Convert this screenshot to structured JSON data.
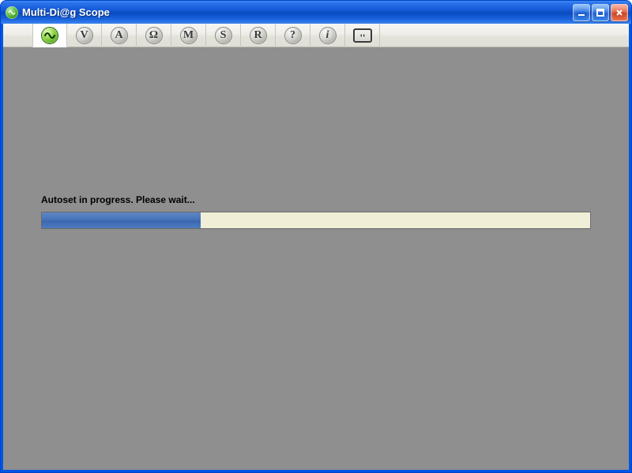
{
  "window": {
    "title": "Multi-Di@g Scope"
  },
  "toolbar": {
    "buttons": [
      {
        "name": "wave-icon",
        "label": "~",
        "active": true,
        "style": "green",
        "symbol": "sine"
      },
      {
        "name": "volts-icon",
        "label": "V",
        "active": false,
        "style": "gray",
        "symbol": "V"
      },
      {
        "name": "amps-icon",
        "label": "A",
        "active": false,
        "style": "gray",
        "symbol": "A"
      },
      {
        "name": "ohms-icon",
        "label": "Ω",
        "active": false,
        "style": "gray",
        "symbol": "Ω"
      },
      {
        "name": "m-icon",
        "label": "M",
        "active": false,
        "style": "gray",
        "symbol": "M"
      },
      {
        "name": "s-icon",
        "label": "S",
        "active": false,
        "style": "gray",
        "symbol": "S"
      },
      {
        "name": "r-icon",
        "label": "R",
        "active": false,
        "style": "gray",
        "symbol": "R"
      },
      {
        "name": "help-icon",
        "label": "?",
        "active": false,
        "style": "gray",
        "symbol": "?"
      },
      {
        "name": "info-icon",
        "label": "i",
        "active": false,
        "style": "gray",
        "symbol": "i"
      },
      {
        "name": "fullscreen-icon",
        "label": "⛶",
        "active": false,
        "style": "rect",
        "symbol": "rect"
      }
    ]
  },
  "status": {
    "message": "Autoset in progress. Please wait...",
    "progress_percent": 29
  },
  "colors": {
    "titlebar_blue": "#1559d6",
    "close_red": "#e25b3a",
    "toolbar_bg": "#efeee9",
    "client_bg": "#8f8f8f",
    "progress_fill": "#4673b9",
    "progress_track": "#f0eed6",
    "active_green": "#96d84a"
  }
}
